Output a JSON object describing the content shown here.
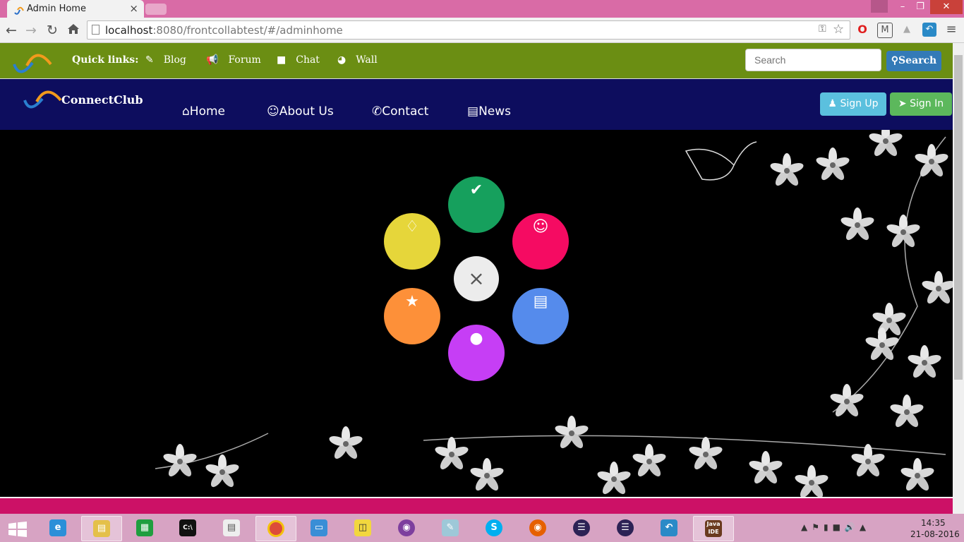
{
  "browser": {
    "tab_title": "Admin Home",
    "tab_close": "×",
    "url_host": "localhost",
    "url_path": ":8080/frontcollabtest/#/adminhome",
    "window_controls": [
      "–",
      "❐",
      "✕"
    ]
  },
  "quicklinks": {
    "label": "Quick links:",
    "items": [
      {
        "label": "Blog",
        "icon": "pencil-icon"
      },
      {
        "label": "Forum",
        "icon": "bullhorn-icon"
      },
      {
        "label": "Chat",
        "icon": "comment-icon"
      },
      {
        "label": "Wall",
        "icon": "dashboard-icon"
      }
    ],
    "search_placeholder": "Search",
    "search_button": "Search"
  },
  "navbar": {
    "brand": "ConnectClub",
    "links": [
      {
        "label": "Home",
        "icon": "home-icon"
      },
      {
        "label": "About Us",
        "icon": "smile-icon"
      },
      {
        "label": "Contact",
        "icon": "phone-icon"
      },
      {
        "label": "News",
        "icon": "newspaper-icon"
      }
    ],
    "signup": "Sign Up",
    "signin": "Sign In"
  },
  "menu": {
    "center_symbol": "×",
    "items": [
      {
        "name": "check",
        "color": "#16a05d",
        "icon": "check-icon"
      },
      {
        "name": "users",
        "color": "#f50b62",
        "icon": "users-icon"
      },
      {
        "name": "news",
        "color": "#558bec",
        "icon": "newspaper-icon"
      },
      {
        "name": "chat",
        "color": "#c63ef5",
        "icon": "comments-icon"
      },
      {
        "name": "star",
        "color": "#fd9039",
        "icon": "star-icon"
      },
      {
        "name": "diamond",
        "color": "#e6d63a",
        "icon": "diamond-icon"
      }
    ]
  },
  "taskbar": {
    "time": "14:35",
    "date": "21-08-2016",
    "apps": [
      "start",
      "internet-explorer",
      "file-explorer",
      "store",
      "command-prompt",
      "reader",
      "chrome",
      "remote-desktop",
      "database",
      "github",
      "notepad",
      "skype",
      "firefox",
      "eclipse",
      "eclipse",
      "ide",
      "java-ee-ide"
    ]
  },
  "colors": {
    "quickbar": "#6b8e13",
    "navbar": "#0d0d5e",
    "footer": "#cc1166",
    "signup": "#5bc0de",
    "signin": "#5cb85c",
    "search_button": "#337ab7"
  }
}
